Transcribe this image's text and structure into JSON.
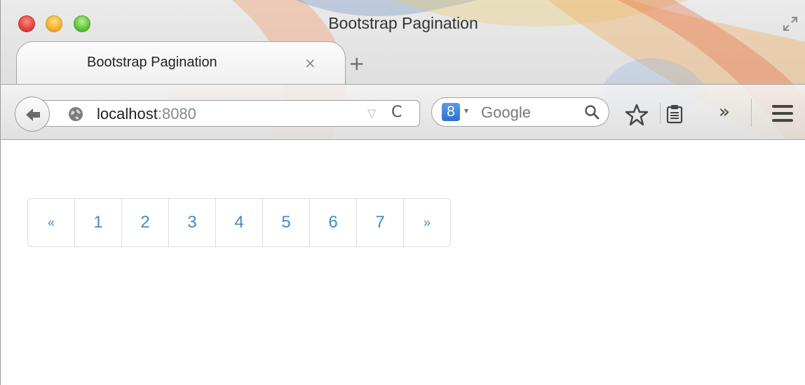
{
  "window": {
    "title": "Bootstrap Pagination"
  },
  "tab": {
    "title": "Bootstrap Pagination",
    "close_glyph": "×",
    "new_tab_glyph": "+"
  },
  "toolbar": {
    "url_host": "localhost",
    "url_port": ":8080",
    "url_dropdown_glyph": "▽",
    "reload_glyph": "C",
    "search_engine_glyph": "8",
    "search_engine_dropdown_glyph": "▾",
    "search_placeholder": "Google",
    "overflow_glyph": "»"
  },
  "icons": {
    "back": "back-arrow-icon",
    "site": "globe-icon",
    "search": "magnifier-icon",
    "bookmark": "star-icon",
    "reading_list": "clipboard-icon",
    "menu": "hamburger-icon",
    "fullscreen": "expand-arrows-icon"
  },
  "pagination": {
    "prev": "«",
    "pages": [
      "1",
      "2",
      "3",
      "4",
      "5",
      "6",
      "7"
    ],
    "next": "»"
  },
  "colors": {
    "link": "#428bca",
    "border": "#dddddd",
    "close": "#e0443e",
    "minimize": "#f5b12c",
    "zoom": "#5fc53a"
  }
}
